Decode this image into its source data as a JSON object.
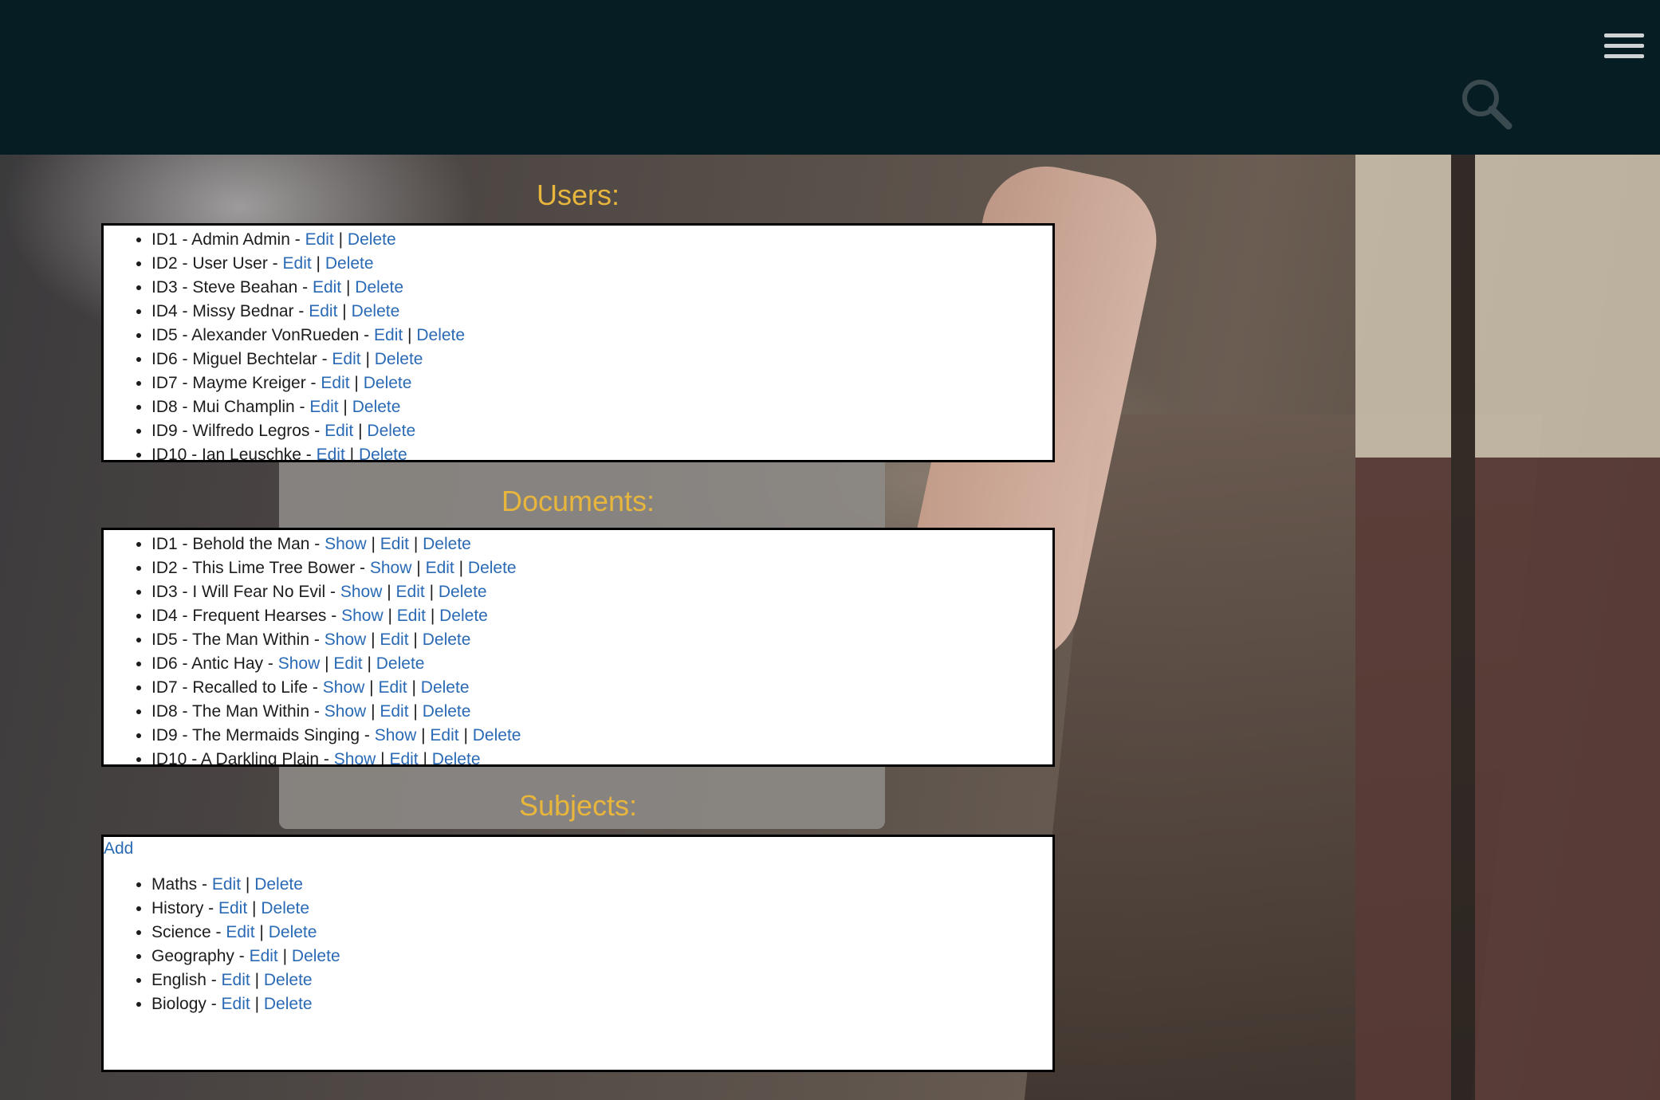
{
  "header": {
    "search_icon": "search-icon",
    "menu_icon": "hamburger-menu-icon"
  },
  "sections": {
    "users": {
      "title": "Users:"
    },
    "documents": {
      "title": "Documents:"
    },
    "subjects": {
      "title": "Subjects:",
      "add_label": "Add"
    }
  },
  "link_labels": {
    "show": "Show",
    "edit": "Edit",
    "delete": "Delete",
    "separator": "|"
  },
  "users": [
    "ID1 - Admin Admin - ",
    "ID2 - User User - ",
    "ID3 - Steve Beahan - ",
    "ID4 - Missy Bednar - ",
    "ID5 - Alexander VonRueden - ",
    "ID6 - Miguel Bechtelar - ",
    "ID7 - Mayme Kreiger - ",
    "ID8 - Mui Champlin - ",
    "ID9 - Wilfredo Legros - ",
    "ID10 - Ian Leuschke - "
  ],
  "documents": [
    "ID1 - Behold the Man - ",
    "ID2 - This Lime Tree Bower - ",
    "ID3 - I Will Fear No Evil - ",
    "ID4 - Frequent Hearses - ",
    "ID5 - The Man Within - ",
    "ID6 - Antic Hay - ",
    "ID7 - Recalled to Life - ",
    "ID8 - The Man Within - ",
    "ID9 - The Mermaids Singing - ",
    "ID10 - A Darkling Plain - "
  ],
  "subjects": [
    "Maths - ",
    "History - ",
    "Science - ",
    "Geography - ",
    "English - ",
    "Biology - "
  ],
  "colors": {
    "header_bg": "#061d24",
    "title": "#e8b63c",
    "link": "#2a6ab5"
  }
}
